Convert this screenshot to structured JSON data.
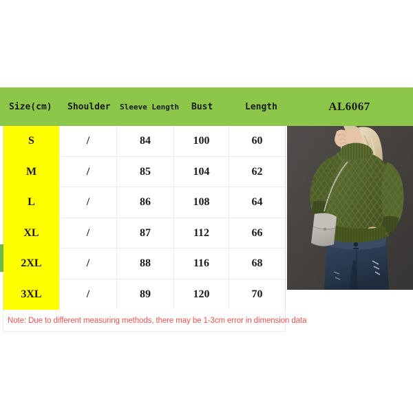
{
  "product": {
    "code": "AL6067"
  },
  "table": {
    "columns": [
      {
        "key": "size",
        "label": "Size(cm)"
      },
      {
        "key": "shoulder",
        "label": "Shoulder"
      },
      {
        "key": "sleeve",
        "label": "Sleeve Length"
      },
      {
        "key": "bust",
        "label": "Bust"
      },
      {
        "key": "length",
        "label": "Length"
      }
    ],
    "rows": [
      {
        "size": "S",
        "shoulder": "/",
        "sleeve": "84",
        "bust": "100",
        "length": "60"
      },
      {
        "size": "M",
        "shoulder": "/",
        "sleeve": "85",
        "bust": "104",
        "length": "62"
      },
      {
        "size": "L",
        "shoulder": "/",
        "sleeve": "86",
        "bust": "108",
        "length": "64"
      },
      {
        "size": "XL",
        "shoulder": "/",
        "sleeve": "87",
        "bust": "112",
        "length": "66"
      },
      {
        "size": "2XL",
        "shoulder": "/",
        "sleeve": "88",
        "bust": "116",
        "length": "68"
      },
      {
        "size": "3XL",
        "shoulder": "/",
        "sleeve": "89",
        "bust": "120",
        "length": "70"
      }
    ]
  },
  "note": {
    "text": "Note: Due to different measuring methods, there may be 1-3cm error in dimension data"
  },
  "photo": {
    "alt": "woman-in-olive-green-cable-knit-turtleneck-sweater-and-blue-jeans"
  },
  "colors": {
    "header_green": "#8cc74a",
    "size_column_yellow": "#ffff00",
    "note_red": "#ef5350",
    "sweater_olive": "#56662f",
    "jeans_blue": "#2c3d54",
    "background_gray": "#4a4745"
  }
}
